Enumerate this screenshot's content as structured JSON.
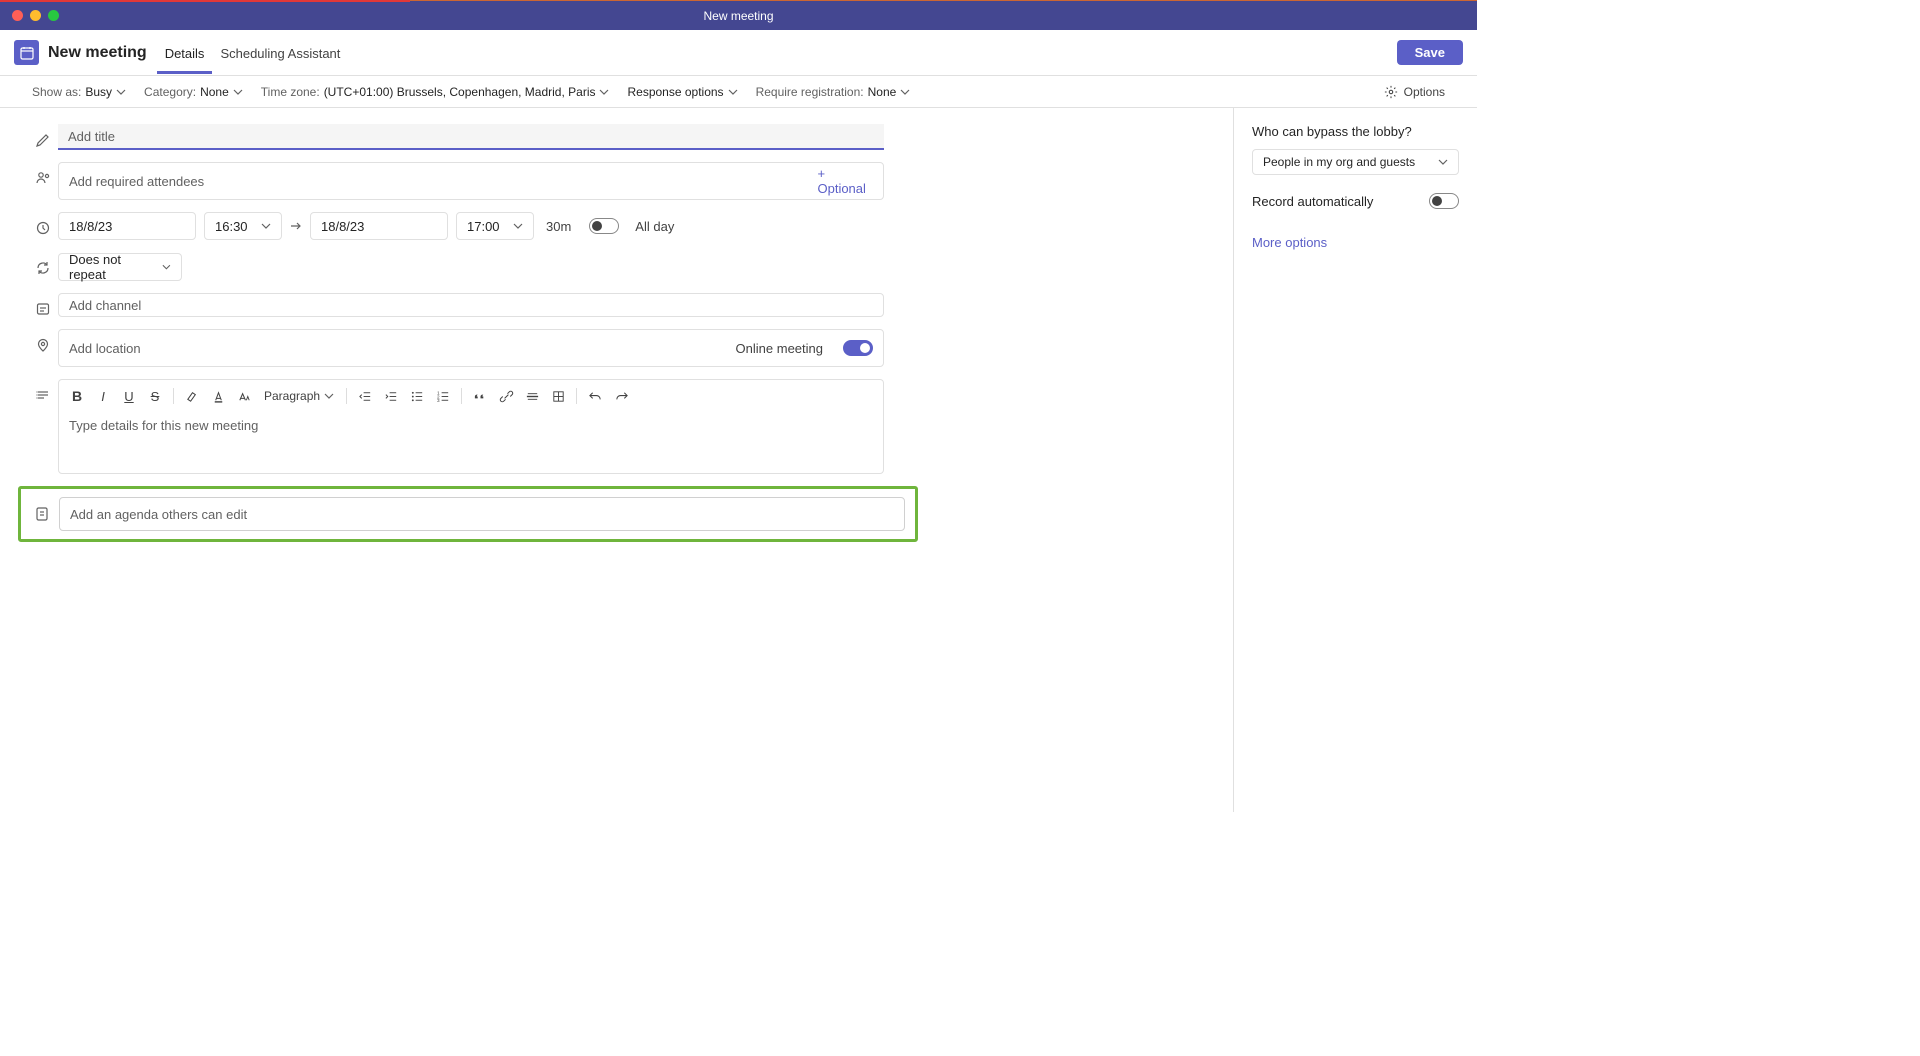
{
  "window": {
    "title": "New meeting"
  },
  "header": {
    "page_title": "New meeting",
    "tabs": {
      "details": "Details",
      "scheduling": "Scheduling Assistant"
    },
    "save": "Save"
  },
  "options_bar": {
    "show_as_label": "Show as:",
    "show_as_value": "Busy",
    "category_label": "Category:",
    "category_value": "None",
    "timezone_label": "Time zone:",
    "timezone_value": "(UTC+01:00) Brussels, Copenhagen, Madrid, Paris",
    "response_options": "Response options",
    "registration_label": "Require registration:",
    "registration_value": "None",
    "options": "Options"
  },
  "form": {
    "title_placeholder": "Add title",
    "attendees_placeholder": "Add required attendees",
    "optional_link": "+ Optional",
    "start_date": "18/8/23",
    "start_time": "16:30",
    "end_date": "18/8/23",
    "end_time": "17:00",
    "duration": "30m",
    "all_day": "All day",
    "repeat": "Does not repeat",
    "channel_placeholder": "Add channel",
    "location_placeholder": "Add location",
    "online_meeting": "Online meeting",
    "editor": {
      "paragraph": "Paragraph",
      "placeholder": "Type details for this new meeting"
    },
    "agenda_placeholder": "Add an agenda others can edit"
  },
  "side": {
    "lobby_question": "Who can bypass the lobby?",
    "lobby_value": "People in my org and guests",
    "record_auto": "Record automatically",
    "more_options": "More options"
  }
}
